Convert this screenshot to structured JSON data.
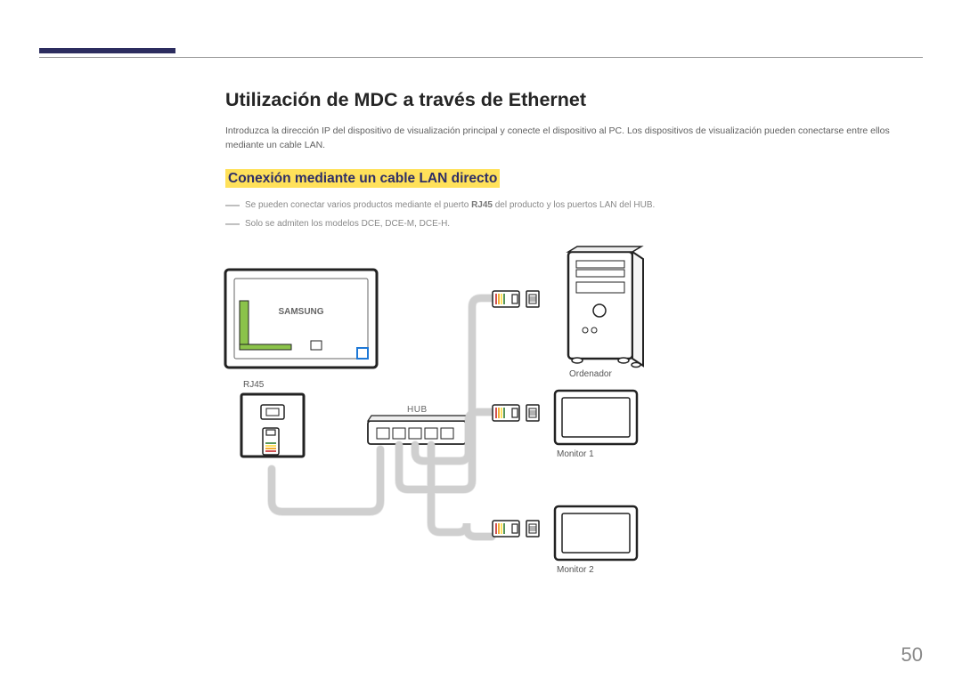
{
  "page": {
    "title": "Utilización de MDC a través de Ethernet",
    "intro": "Introduzca la dirección IP del dispositivo de visualización principal y conecte el dispositivo al PC. Los dispositivos de visualización pueden conectarse entre ellos mediante un cable LAN.",
    "subtitle": "Conexión mediante un cable LAN directo",
    "note1_pre": "Se pueden conectar varios productos mediante el puerto ",
    "note1_bold": "RJ45",
    "note1_post": " del producto y los puertos LAN del HUB.",
    "note2": "Solo se admiten los modelos DCE, DCE-M, DCE-H.",
    "number": "50"
  },
  "diagram": {
    "labels": {
      "rj45": "RJ45",
      "hub": "HUB",
      "ordenador": "Ordenador",
      "monitor1": "Monitor 1",
      "monitor2": "Monitor 2",
      "brand": "SAMSUNG"
    }
  }
}
